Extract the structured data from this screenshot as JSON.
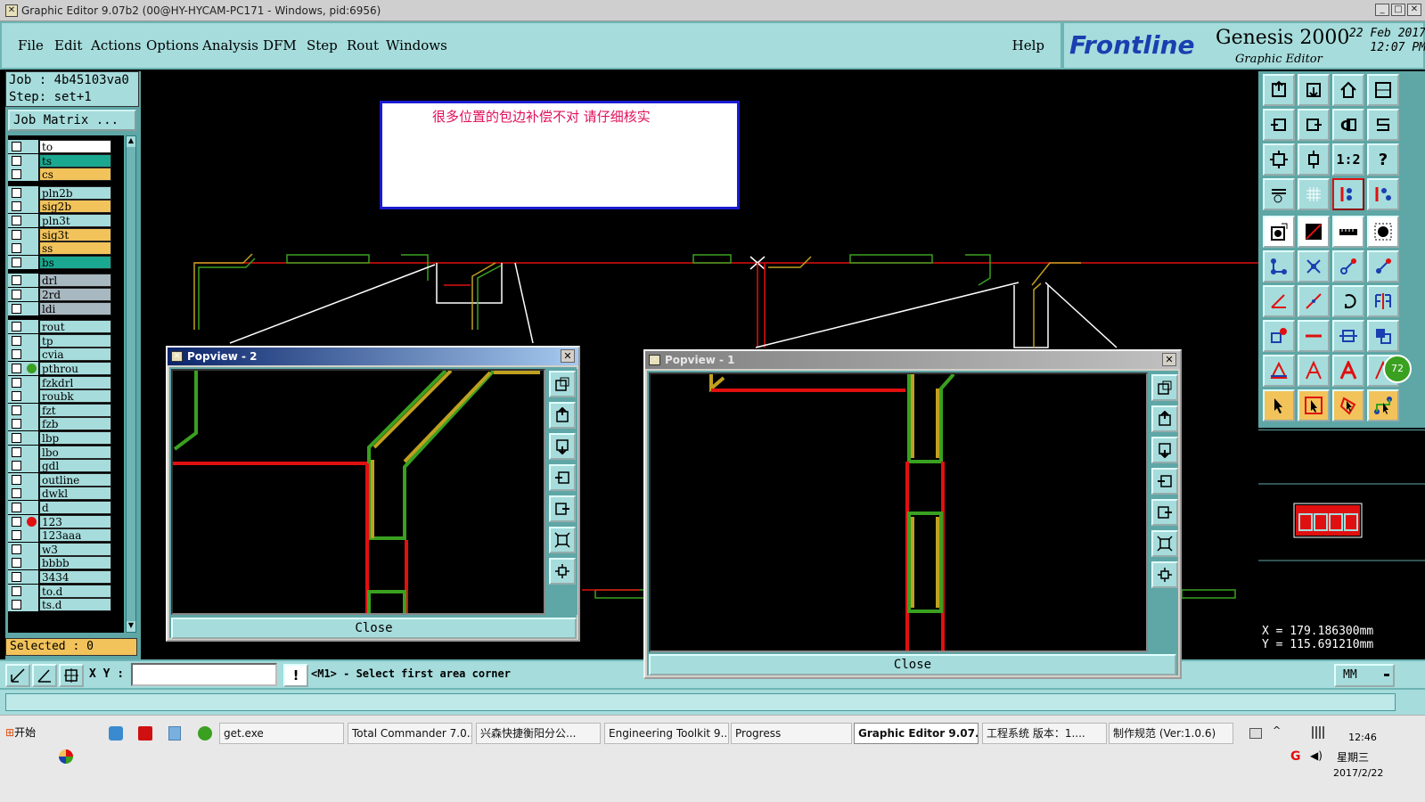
{
  "window": {
    "title": "Graphic Editor 9.07b2 (00@HY-HYCAM-PC171 - Windows, pid:6956)"
  },
  "menu": {
    "items": [
      "File",
      "Edit",
      "Actions",
      "Options",
      "Analysis",
      "DFM",
      "Step",
      "Rout",
      "Windows"
    ],
    "help": "Help"
  },
  "brand": {
    "logo": "Frontline",
    "product": "Genesis 2000",
    "subtitle": "Graphic Editor",
    "date": "22 Feb 2017",
    "time": "12:07 PM"
  },
  "job": {
    "job_line": "Job : 4b45103va0",
    "step_line": "Step: set+1",
    "matrix_button": "Job Matrix ..."
  },
  "layers": [
    {
      "name": "to",
      "color": "#ffffff",
      "marker": ""
    },
    {
      "name": "ts",
      "color": "#1aa890",
      "marker": ""
    },
    {
      "name": "cs",
      "color": "#f2c35a",
      "marker": ""
    },
    {
      "name": "pln2b",
      "color": "#a6dcdc",
      "marker": ""
    },
    {
      "name": "sig2b",
      "color": "#f2c35a",
      "marker": ""
    },
    {
      "name": "pln3t",
      "color": "#a6dcdc",
      "marker": ""
    },
    {
      "name": "sig3t",
      "color": "#f2c35a",
      "marker": ""
    },
    {
      "name": "ss",
      "color": "#f2c35a",
      "marker": ""
    },
    {
      "name": "bs",
      "color": "#1aa890",
      "marker": ""
    },
    {
      "name": "drl",
      "color": "#a8b8c0",
      "marker": ""
    },
    {
      "name": "2rd",
      "color": "#a8b8c0",
      "marker": ""
    },
    {
      "name": "ldi",
      "color": "#a8b8c0",
      "marker": ""
    },
    {
      "name": "rout",
      "color": "#a6dcdc",
      "marker": ""
    },
    {
      "name": "tp",
      "color": "#a6dcdc",
      "marker": ""
    },
    {
      "name": "cvia",
      "color": "#a6dcdc",
      "marker": ""
    },
    {
      "name": "pthrou",
      "color": "#a6dcdc",
      "marker": "green"
    },
    {
      "name": "fzkdrl",
      "color": "#a6dcdc",
      "marker": ""
    },
    {
      "name": "roubk",
      "color": "#a6dcdc",
      "marker": ""
    },
    {
      "name": "fzt",
      "color": "#a6dcdc",
      "marker": ""
    },
    {
      "name": "fzb",
      "color": "#a6dcdc",
      "marker": ""
    },
    {
      "name": "lbp",
      "color": "#a6dcdc",
      "marker": ""
    },
    {
      "name": "lbo",
      "color": "#a6dcdc",
      "marker": ""
    },
    {
      "name": "gdl",
      "color": "#a6dcdc",
      "marker": ""
    },
    {
      "name": "outline",
      "color": "#a6dcdc",
      "marker": ""
    },
    {
      "name": "dwkl",
      "color": "#a6dcdc",
      "marker": ""
    },
    {
      "name": "d",
      "color": "#a6dcdc",
      "marker": ""
    },
    {
      "name": "123",
      "color": "#a6dcdc",
      "marker": "red"
    },
    {
      "name": "123aaa",
      "color": "#a6dcdc",
      "marker": ""
    },
    {
      "name": "w3",
      "color": "#a6dcdc",
      "marker": ""
    },
    {
      "name": "bbbb",
      "color": "#a6dcdc",
      "marker": ""
    },
    {
      "name": "3434",
      "color": "#a6dcdc",
      "marker": ""
    },
    {
      "name": "to.d",
      "color": "#a6dcdc",
      "marker": ""
    },
    {
      "name": "ts.d",
      "color": "#a6dcdc",
      "marker": ""
    }
  ],
  "selected": "Selected : 0",
  "message_note": "很多位置的包边补偿不对   请仔细核实",
  "popview2": {
    "title": "Popview - 2",
    "close": "Close"
  },
  "popview1": {
    "title": "Popview - 1",
    "close": "Close"
  },
  "coords": {
    "x": "X =  179.186300mm",
    "y": "Y =  115.691210mm"
  },
  "bottom": {
    "xy_label": "X Y :",
    "xy_value": "",
    "prompt": "<M1> - Select first area corner",
    "units": "MM",
    "indicator": "72"
  },
  "taskbar": {
    "start": "开始",
    "tasks": [
      "get.exe",
      "Total Commander 7.0...",
      "兴森快捷衡阳分公...",
      "Engineering Toolkit 9....",
      "Progress",
      "Graphic Editor 9.07...",
      "工程系统  版本：1....",
      "制作规范 (Ver:1.0.6)"
    ],
    "clock_time": "12:46",
    "clock_day": "星期三",
    "clock_date": "2017/2/22"
  },
  "colors": {
    "panel": "#a6dcdc",
    "panel_dark": "#5fa6a6",
    "trace_red": "#e01010",
    "trace_green": "#3aa020",
    "trace_gold": "#c0a020"
  }
}
